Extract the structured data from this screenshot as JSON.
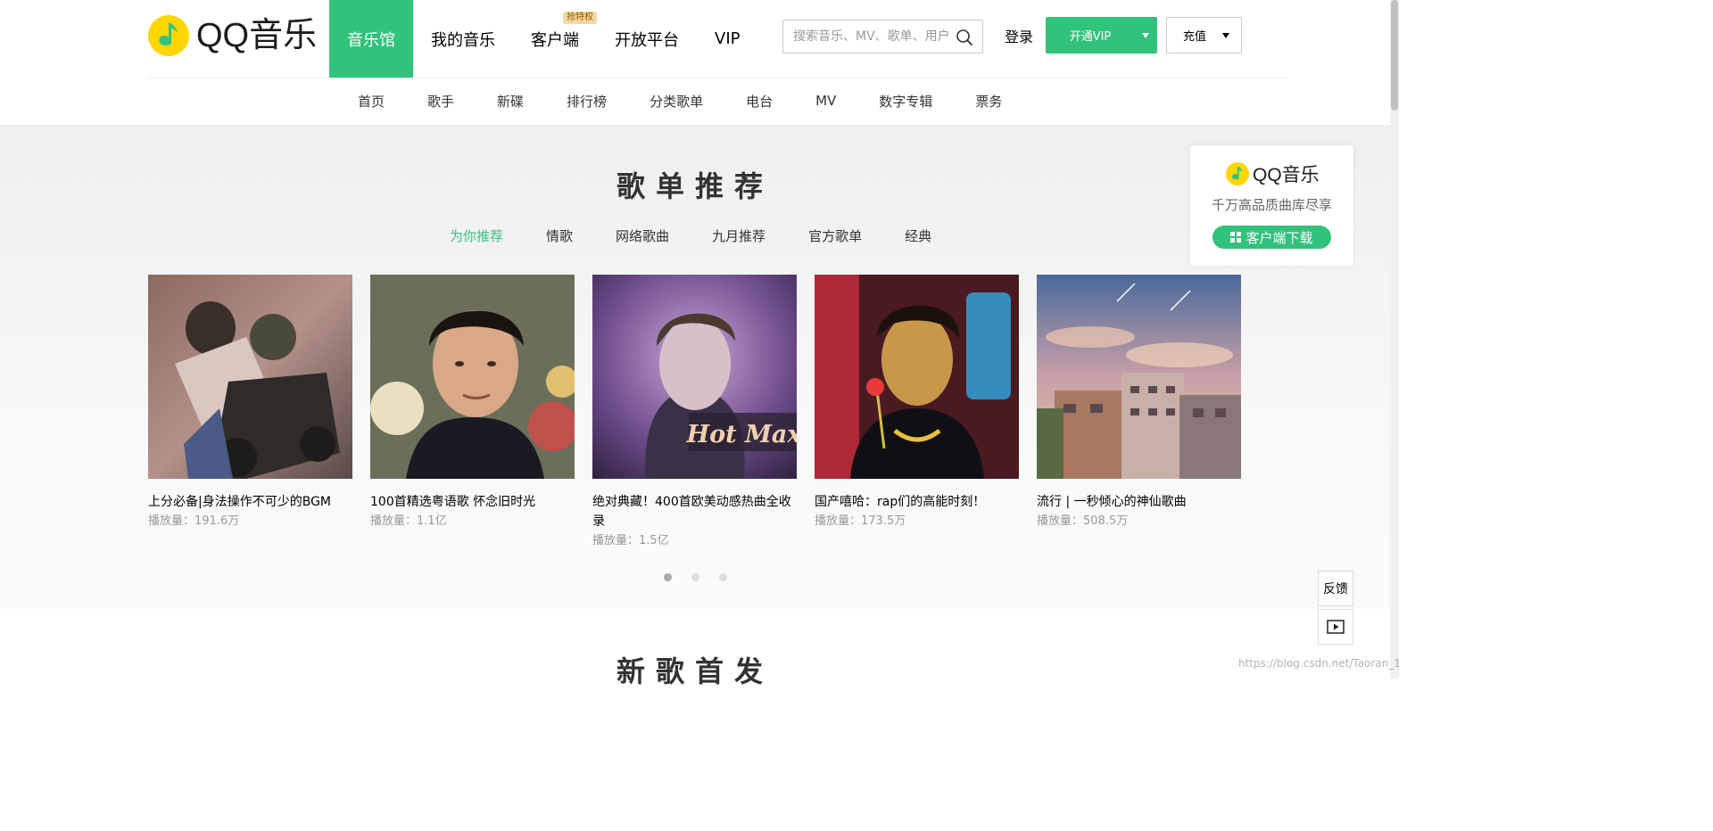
{
  "header": {
    "logo_text": "QQ音乐",
    "nav": [
      {
        "label": "音乐馆",
        "active": true
      },
      {
        "label": "我的音乐"
      },
      {
        "label": "客户端",
        "badge": "抢特权"
      },
      {
        "label": "开放平台"
      },
      {
        "label": "VIP"
      }
    ],
    "search_placeholder": "搜索音乐、MV、歌单、用户",
    "login_label": "登录",
    "vip_button_label": "开通VIP",
    "recharge_label": "充值"
  },
  "sub_nav": [
    "首页",
    "歌手",
    "新碟",
    "排行榜",
    "分类歌单",
    "电台",
    "MV",
    "数字专辑",
    "票务"
  ],
  "playlist_section": {
    "title": "歌单推荐",
    "tabs": [
      "为你推荐",
      "情歌",
      "网络歌曲",
      "九月推荐",
      "官方歌单",
      "经典"
    ],
    "active_tab": 0,
    "cards": [
      {
        "title": "上分必备|身法操作不可少的BGM",
        "plays": "播放量：191.6万"
      },
      {
        "title": "100首精选粤语歌 怀念旧时光",
        "plays": "播放量：1.1亿"
      },
      {
        "title": "绝对典藏！400首欧美动感热曲全收录",
        "plays": "播放量：1.5亿",
        "cover_text": "Hot Max"
      },
      {
        "title": "国产嘻哈：rap们的高能时刻！",
        "plays": "播放量：173.5万"
      },
      {
        "title": "流行 | 一秒倾心的神仙歌曲",
        "plays": "播放量：508.5万"
      }
    ],
    "pages": 3,
    "current_page": 0
  },
  "new_songs_section": {
    "title": "新歌首发"
  },
  "promo": {
    "logo_text": "QQ音乐",
    "tagline": "千万高品质曲库尽享",
    "button_label": "客户端下载"
  },
  "feedback_label": "反馈",
  "watermark": "https://blog.csdn.net/Taoran_1",
  "colors": {
    "accent": "#31c27c",
    "logo_yellow": "#ffd600"
  }
}
